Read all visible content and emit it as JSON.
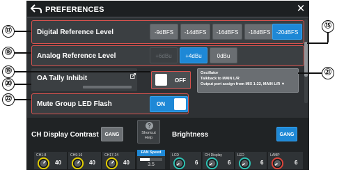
{
  "dialog": {
    "title": "PREFERENCES"
  },
  "callouts": {
    "c17": "⑰",
    "c18": "⑱",
    "c19": "⑲",
    "c20": "⑳",
    "c21": "㉑",
    "c22": "㉒",
    "c15": "⑮"
  },
  "digital_ref": {
    "label": "Digital Reference Level",
    "options": [
      "-9dBFS",
      "-14dBFS",
      "-16dBFS",
      "-18dBFS",
      "-20dBFS"
    ],
    "selected": "-20dBFS"
  },
  "analog_ref": {
    "label": "Analog Reference Level",
    "options": [
      "+6dBu",
      "+4dBu",
      "0dBu"
    ],
    "selected": "+4dBu",
    "disabled": "+6dBu"
  },
  "oa_tally": {
    "label": "OA Tally Inhibit",
    "state": "OFF"
  },
  "oscillator": {
    "title": "Oscillator",
    "line1": "Talkback to MAIN L/R",
    "line2": "Output port assign from MIX 1-22, MAIN L/R ▼"
  },
  "mute_led": {
    "label": "Mute Group LED Flash",
    "state": "ON"
  },
  "ch_display": {
    "label": "CH Display Contrast",
    "gang": "GANG"
  },
  "shortcut": {
    "line1": "Shortcut",
    "line2": "Help",
    "icon": "?"
  },
  "brightness": {
    "label": "Brightness",
    "gang": "GANG"
  },
  "fan": {
    "label": "FAN Speed",
    "value": "3.5",
    "level": 0.45
  },
  "contrast_knobs": [
    {
      "label": "CH1-8",
      "value": "40"
    },
    {
      "label": "CH9-16",
      "value": "40"
    },
    {
      "label": "CH17-24",
      "value": "40"
    }
  ],
  "brightness_knobs": [
    {
      "label": "LCD",
      "value": "6"
    },
    {
      "label": "CH Display",
      "value": "6"
    },
    {
      "label": "LED",
      "value": "6"
    },
    {
      "label": "LAMP",
      "value": "6"
    }
  ],
  "colors": {
    "accent": "#1e88d6",
    "highlight": "#d9534f",
    "knob_ring_contrast": "#e8d200",
    "knob_ring_brightness": "#2ec4b6",
    "knob_ring_lamp": "#e0453a"
  }
}
